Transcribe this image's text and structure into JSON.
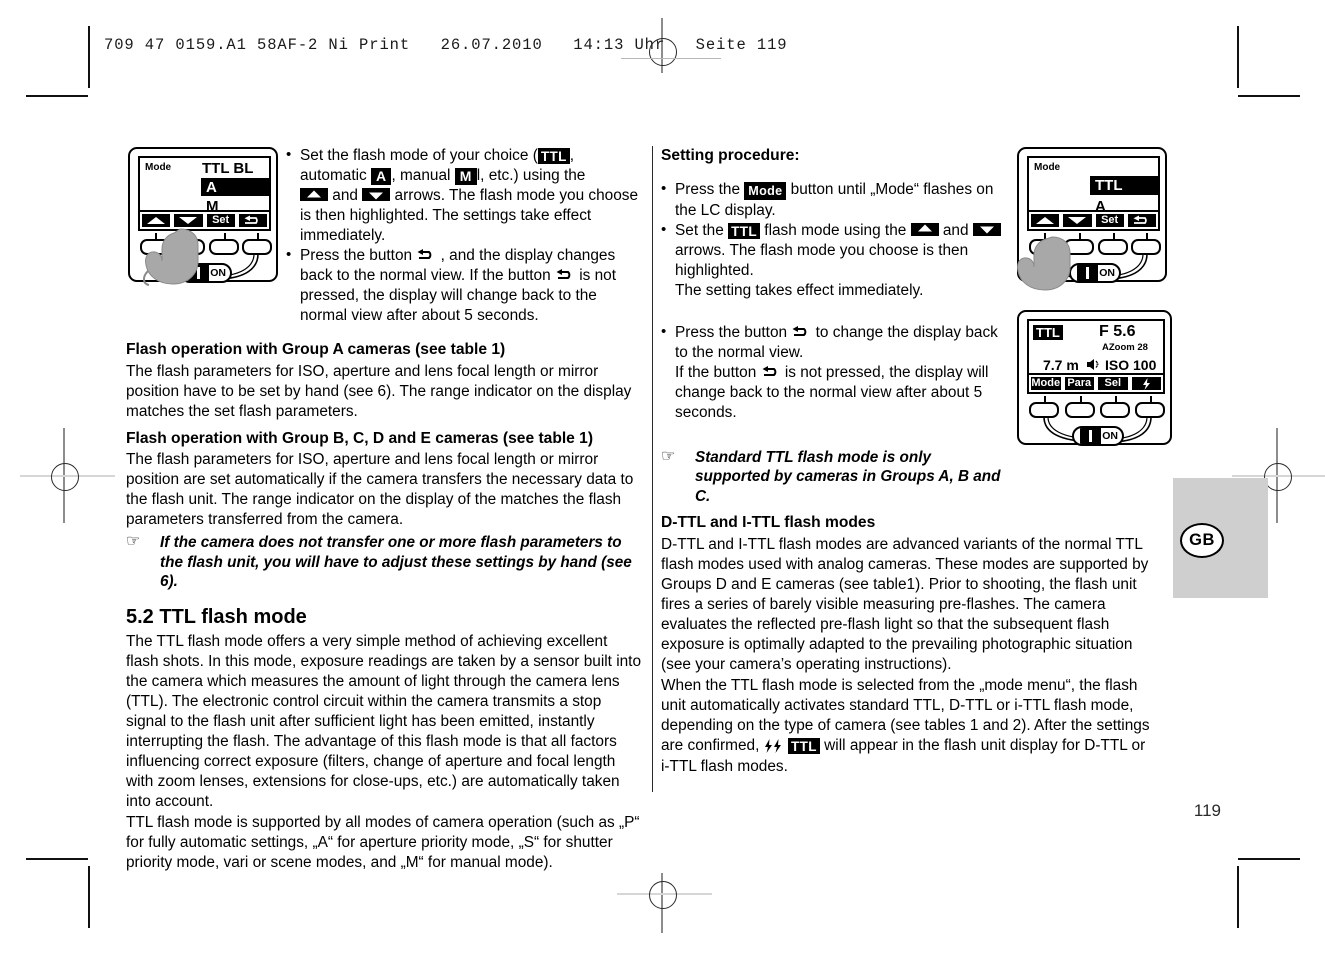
{
  "print_header": {
    "imprint": "709 47 0159.A1 58AF-2 Ni Print   26.07.2010   14:13 Uhr   Seite 119"
  },
  "page": {
    "number": "119",
    "language_badge": "GB"
  },
  "left_column": {
    "figure1": {
      "label_mode": "Mode",
      "row1": "TTL BL",
      "row2": "A",
      "row3": "M",
      "btn_up": "up-arrow",
      "btn_down": "down-arrow",
      "btn_set": "Set",
      "btn_return": "return-arrow",
      "switch_on": "ON"
    },
    "bullet1": {
      "t1": "Set the flash mode of your choice (",
      "badge_ttl": "TTL",
      "t2": ", automatic ",
      "badge_a": "A",
      "t3": ", manual ",
      "badge_m": "M",
      "t4": "l, etc.) using the ",
      "t5": " and ",
      "t6": " arrows. The flash mode you choose is then highlighted. The settings take effect immediately."
    },
    "bullet2": {
      "t1": "Press the  button ",
      "t2": " , and the display changes back to the normal view.  If the button ",
      "t3": " is not pressed, the display will change back to the normal view after about 5 seconds."
    },
    "heading_groupA": "Flash operation with Group A cameras (see table 1)",
    "para_groupA": "The flash parameters for ISO, aperture and lens focal length or mirror position have to be set by hand (see 6). The range indicator on the display matches the set flash parameters.",
    "heading_groupBCDE": "Flash operation with Group B, C, D and E cameras (see table 1)",
    "para_groupBCDE": "The flash parameters for ISO, aperture and lens focal length or mirror position are set automatically if the camera transfers the necessary data to the flash unit. The range indicator on the display of the matches the flash parameters transferred from the camera.",
    "note1": "If the camera does not transfer one or more flash parameters to the flash unit, you will have to adjust these settings by hand (see 6).",
    "section_title": "5.2 TTL flash mode",
    "para_ttl_1": "The TTL flash mode offers a very simple method of achieving excellent flash shots. In this mode, exposure readings are taken by a sensor built into the camera which measures the amount of light through the camera lens (TTL). The electronic control circuit within the camera transmits a stop signal to the flash unit after sufficient light has been emitted, instantly interrupting the flash. The advantage of this flash mode is that all factors influencing correct exposure (filters, change of aperture and focal length with zoom lenses, extensions for close-ups, etc.) are automatically taken into account.",
    "para_ttl_2": "TTL flash mode is supported by all modes of camera operation (such as „P“ for fully automatic settings, „A“ for aperture priority mode, „S“ for shutter priority mode, vari or scene modes, and „M“ for manual mode)."
  },
  "right_column": {
    "heading_setting": "Setting procedure:",
    "bullet1": {
      "t1": "Press the ",
      "badge_mode": "Mode",
      "t2": " button until „Mode“ flashes on the LC display."
    },
    "bullet2": {
      "t1": "Set the ",
      "badge_ttl": "TTL",
      "t2": " flash mode using the ",
      "t3": " and ",
      "t4": " arrows. The flash mode you choose is then highlighted.",
      "t5": "The setting takes effect immediately."
    },
    "bullet3": {
      "t1": "Press the button ",
      "t2": " to change the display back to the normal view.",
      "t3": "If the button ",
      "t4": " is not pressed, the display will change back to the normal view after about 5 seconds."
    },
    "note1": "Standard TTL flash mode is only supported by cameras in Groups A, B and C.",
    "heading_dttl": "D-TTL and I-TTL flash modes",
    "para_dttl_1": "D-TTL and I-TTL flash modes are advanced variants of the normal TTL flash modes used with analog cameras. These modes are supported by Groups D and E cameras (see table1). Prior to shooting, the flash unit fires a series of barely visible measuring pre-flashes. The camera evaluates the reflected pre-flash light so that the subsequent flash exposure is optimally adapted to the prevailing photographic situation (see your camera’s operating instructions).",
    "para_dttl_2": {
      "t1": "When the TTL flash mode is selected from the „mode menu“, the flash unit automatically activates standard TTL, D-TTL or i-TTL flash mode, depending on the type of camera (see tables 1 and 2). After the settings are confirmed, ",
      "bolt": "⚡⚡",
      "badge_ttl": "TTL",
      "t2": " will appear in the flash unit display for D-TTL or i-TTL flash modes."
    },
    "figure2": {
      "label_mode": "Mode",
      "row1": "TTL",
      "row2": "A",
      "btn_up": "up-arrow",
      "btn_down": "down-arrow",
      "btn_set": "Set",
      "btn_return": "return-arrow",
      "switch_on": "ON"
    },
    "figure3": {
      "badge_ttl": "TTL",
      "aperture": "F 5.6",
      "azoom": "AZoom  28",
      "distance": "7.7 m",
      "iso": "ISO 100",
      "speaker_icon": "speaker-icon",
      "btn_mode": "Mode",
      "btn_para": "Para",
      "btn_sel": "Sel",
      "btn_flash": "flash-bolt",
      "switch_on": "ON"
    }
  }
}
